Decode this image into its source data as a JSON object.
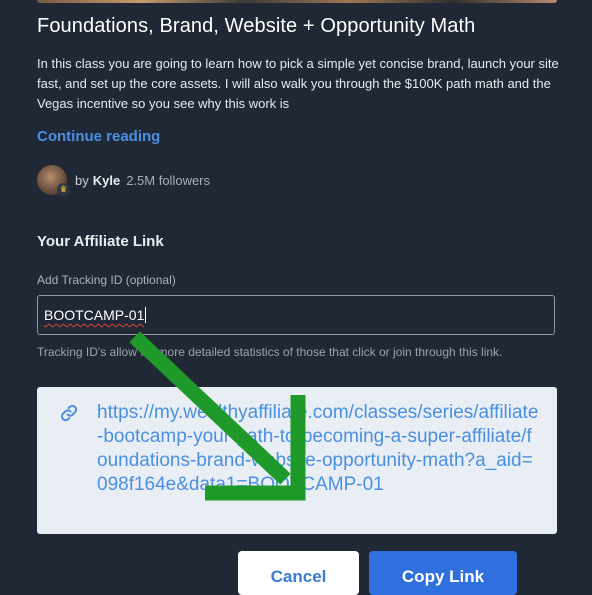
{
  "course": {
    "title": "Foundations, Brand, Website + Opportunity Math",
    "description": "In this class you are going to learn how to pick a simple yet concise brand, launch your site fast, and set up the core assets. I will also walk you through the $100K path math and the Vegas incentive so you see why this work is",
    "continue_label": "Continue reading"
  },
  "author": {
    "by_label": "by",
    "name": "Kyle",
    "followers": "2.5M followers"
  },
  "affiliate": {
    "heading": "Your Affiliate Link",
    "tracking_label": "Add Tracking ID (optional)",
    "tracking_value": "BOOTCAMP-01",
    "help_text": "Tracking ID's allow for more detailed statistics of those that click or join through this link.",
    "link_url": "https://my.wealthyaffiliate.com/classes/series/affiliate-bootcamp-your-path-to-becoming-a-super-affiliate/foundations-brand-website-opportunity-math?a_aid=098f164e&data1=BOOTCAMP-01"
  },
  "buttons": {
    "cancel": "Cancel",
    "copy": "Copy Link"
  },
  "colors": {
    "background": "#1f2834",
    "link": "#4a90e2",
    "primary_button": "#2f6fde",
    "annotation_arrow": "#1f9a2a"
  },
  "icons": {
    "link": "link-icon",
    "crown": "crown-icon",
    "arrow": "arrow-annotation"
  }
}
